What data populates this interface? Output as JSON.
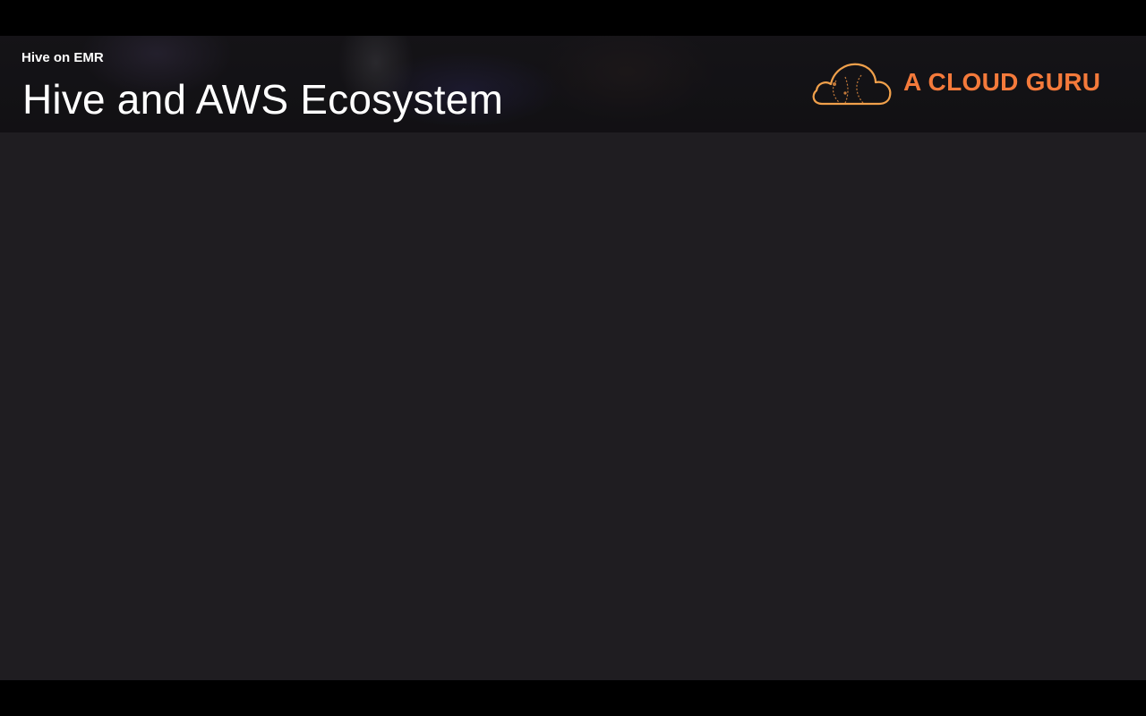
{
  "slide": {
    "kicker": "Hive on EMR",
    "title": "Hive and AWS Ecosystem"
  },
  "brand": {
    "name": "A CLOUD GURU",
    "icon": "cloud-icon",
    "accent_color": "#f47a3b"
  },
  "theme": {
    "background": "#1f1d21",
    "letterbox": "#000000",
    "text_color": "#ffffff"
  }
}
